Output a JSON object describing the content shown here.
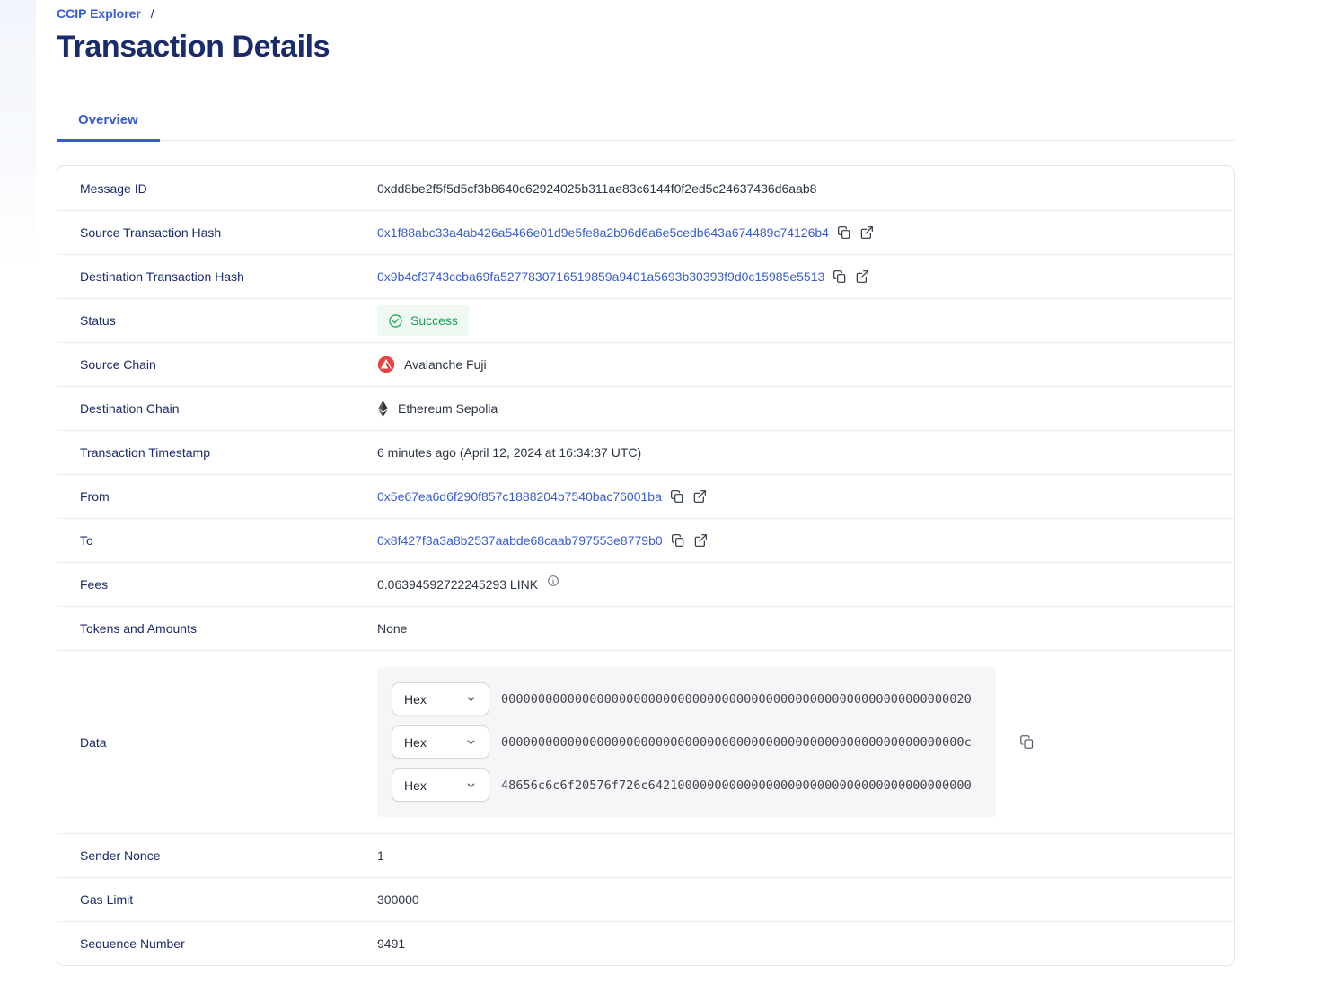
{
  "breadcrumb": {
    "label": "CCIP Explorer",
    "separator": "/"
  },
  "title": "Transaction Details",
  "tabs": {
    "overview": "Overview"
  },
  "colors": {
    "accent_blue": "#375bd2",
    "heading_navy": "#1a2b6b",
    "success_text": "#1ca05a",
    "success_bg": "#eff9f2",
    "avalanche_red": "#e84142",
    "ethereum_dark": "#343434"
  },
  "icons": {
    "copy": "copy-icon",
    "external_link": "external-link-icon",
    "check_circle": "check-circle-icon",
    "avalanche": "avalanche-logo-icon",
    "ethereum": "ethereum-logo-icon",
    "info": "info-icon",
    "chevron": "chevron-down-icon"
  },
  "rows": {
    "message_id": {
      "label": "Message ID",
      "value": "0xdd8be2f5f5d5cf3b8640c62924025b311ae83c6144f0f2ed5c24637436d6aab8"
    },
    "source_tx": {
      "label": "Source Transaction Hash",
      "value": "0x1f88abc33a4ab426a5466e01d9e5fe8a2b96d6a6e5cedb643a674489c74126b4"
    },
    "dest_tx": {
      "label": "Destination Transaction Hash",
      "value": "0x9b4cf3743ccba69fa5277830716519859a9401a5693b30393f9d0c15985e5513"
    },
    "status": {
      "label": "Status",
      "value": "Success"
    },
    "source_chain": {
      "label": "Source Chain",
      "value": "Avalanche Fuji"
    },
    "dest_chain": {
      "label": "Destination Chain",
      "value": "Ethereum Sepolia"
    },
    "timestamp": {
      "label": "Transaction Timestamp",
      "value": "6 minutes ago (April 12, 2024 at 16:34:37 UTC)"
    },
    "from": {
      "label": "From",
      "value": "0x5e67ea6d6f290f857c1888204b7540bac76001ba"
    },
    "to": {
      "label": "To",
      "value": "0x8f427f3a3a8b2537aabde68caab797553e8779b0"
    },
    "fees": {
      "label": "Fees",
      "value": "0.06394592722245293 LINK"
    },
    "tokens": {
      "label": "Tokens and Amounts",
      "value": "None"
    },
    "data": {
      "label": "Data",
      "format": "Hex",
      "lines": [
        "0000000000000000000000000000000000000000000000000000000000000020",
        "000000000000000000000000000000000000000000000000000000000000000c",
        "48656c6c6f20576f726c64210000000000000000000000000000000000000000"
      ]
    },
    "sender_nonce": {
      "label": "Sender Nonce",
      "value": "1"
    },
    "gas_limit": {
      "label": "Gas Limit",
      "value": "300000"
    },
    "sequence_number": {
      "label": "Sequence Number",
      "value": "9491"
    }
  }
}
